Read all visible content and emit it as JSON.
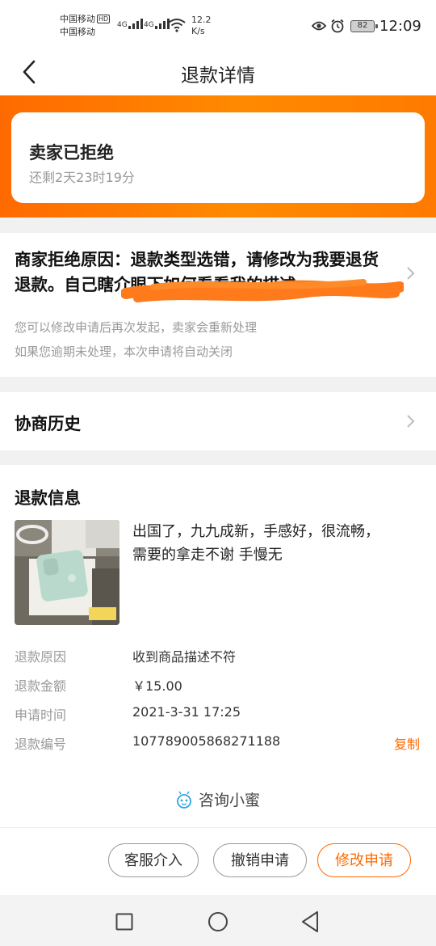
{
  "status_bar": {
    "carrier_1": "中国移动",
    "hd_badge": "HD",
    "carrier_2": "中国移动",
    "net_1": "4G",
    "net_2": "4G",
    "speed_value": "12.2",
    "speed_unit": "K/s",
    "battery": "82",
    "time": "12:09"
  },
  "nav": {
    "title": "退款详情",
    "back_icon": "chevron-left-icon"
  },
  "status": {
    "title": "卖家已拒绝",
    "remaining": "还剩2天23时19分"
  },
  "reason": {
    "text": "商家拒绝原因：退款类型选错，请修改为我要退货退款。自己瞎介眼下如何看看我的描述",
    "note_1": "您可以修改申请后再次发起，卖家会重新处理",
    "note_2": "如果您逾期未处理，本次申请将自动关闭",
    "scribble_color": "#ff7a1a"
  },
  "history": {
    "title": "协商历史"
  },
  "refund": {
    "title": "退款信息",
    "product_desc": "出国了，九九成新，手感好，很流畅，需要的拿走不谢 手慢无",
    "rows": [
      {
        "label": "退款原因",
        "value": "收到商品描述不符"
      },
      {
        "label": "退款金额",
        "value": "￥15.00"
      },
      {
        "label": "申请时间",
        "value": "2021-3-31 17:25"
      },
      {
        "label": "退款编号",
        "value": "107789005868271188"
      }
    ],
    "copy_label": "复制"
  },
  "consult": {
    "label": "咨询小蜜",
    "icon": "bee-mascot-icon"
  },
  "actions": {
    "service": "客服介入",
    "cancel": "撤销申请",
    "modify": "修改申请"
  },
  "colors": {
    "accent": "#ff6a00",
    "banner_start": "#ff6a00",
    "banner_end": "#ff8a00"
  }
}
